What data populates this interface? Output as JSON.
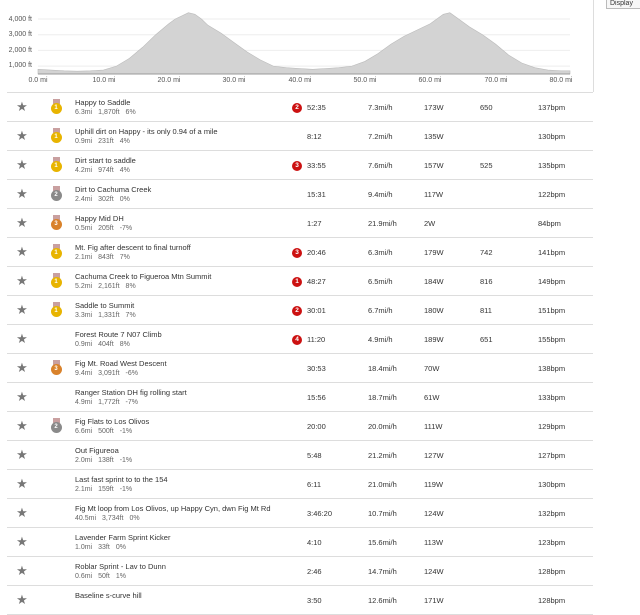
{
  "display_button": "Display",
  "chart": {
    "y_ticks": [
      "4,000 ft",
      "3,000 ft",
      "2,000 ft",
      "1,000 ft"
    ],
    "x_ticks": [
      "0.0 mi",
      "10.0 mi",
      "20.0 mi",
      "30.0 mi",
      "40.0 mi",
      "50.0 mi",
      "60.0 mi",
      "70.0 mi",
      "80.0 mi"
    ],
    "fill_color": "#d3d3d3"
  },
  "chart_data": {
    "type": "area",
    "xlabel": "",
    "ylabel": "",
    "xlim": [
      0,
      80
    ],
    "ylim": [
      500,
      4700
    ],
    "x": [
      0,
      2,
      4,
      6,
      8,
      10,
      12,
      14,
      16,
      18,
      20,
      21,
      22,
      23,
      24,
      25,
      26,
      28,
      30,
      32,
      34,
      36,
      38,
      40,
      42,
      44,
      46,
      48,
      50,
      52,
      54,
      56,
      58,
      60,
      61,
      62,
      63,
      64,
      65,
      66,
      68,
      70,
      72,
      74,
      76,
      78,
      80
    ],
    "y": [
      800,
      750,
      700,
      680,
      700,
      750,
      1000,
      1500,
      2200,
      3000,
      3700,
      4000,
      4200,
      4400,
      4300,
      4000,
      3600,
      3100,
      2500,
      1900,
      1400,
      1000,
      900,
      850,
      800,
      850,
      900,
      1000,
      1300,
      1800,
      2400,
      2900,
      3300,
      3700,
      4000,
      4300,
      4400,
      4100,
      3800,
      3500,
      3000,
      2400,
      1700,
      1200,
      900,
      750,
      700
    ]
  },
  "colors": {
    "rank_red": "#cc1111",
    "medal_gold": "#e8b400",
    "medal_silver": "#8a8a8a",
    "medal_bronze": "#d9822b",
    "ribbon": "#c9a0a0"
  },
  "segments": [
    {
      "name": "Happy to Saddle",
      "distance": "6.3mi",
      "elev": "1,870ft",
      "grade": "6%",
      "medal": "gold",
      "medal_num": "1",
      "rank": "2",
      "time": "52:35",
      "speed": "7.3mi/h",
      "power": "173W",
      "vam": "650",
      "hr": "137bpm"
    },
    {
      "name": "Uphill dirt on Happy - its only 0.94 of a mile",
      "distance": "0.9mi",
      "elev": "231ft",
      "grade": "4%",
      "medal": "gold",
      "medal_num": "1",
      "rank": "",
      "time": "8:12",
      "speed": "7.2mi/h",
      "power": "135W",
      "vam": "",
      "hr": "130bpm"
    },
    {
      "name": "Dirt start to saddle",
      "distance": "4.2mi",
      "elev": "974ft",
      "grade": "4%",
      "medal": "gold",
      "medal_num": "1",
      "rank": "3",
      "time": "33:55",
      "speed": "7.6mi/h",
      "power": "157W",
      "vam": "525",
      "hr": "135bpm"
    },
    {
      "name": "Dirt to Cachuma Creek",
      "distance": "2.4mi",
      "elev": "302ft",
      "grade": "0%",
      "medal": "silver",
      "medal_num": "2",
      "rank": "",
      "time": "15:31",
      "speed": "9.4mi/h",
      "power": "117W",
      "vam": "",
      "hr": "122bpm"
    },
    {
      "name": "Happy Mid DH",
      "distance": "0.5mi",
      "elev": "205ft",
      "grade": "-7%",
      "medal": "bronze",
      "medal_num": "3",
      "rank": "",
      "time": "1:27",
      "speed": "21.9mi/h",
      "power": "2W",
      "vam": "",
      "hr": "84bpm"
    },
    {
      "name": "Mt. Fig after descent to final turnoff",
      "distance": "2.1mi",
      "elev": "843ft",
      "grade": "7%",
      "medal": "gold",
      "medal_num": "1",
      "rank": "3",
      "time": "20:46",
      "speed": "6.3mi/h",
      "power": "179W",
      "vam": "742",
      "hr": "141bpm"
    },
    {
      "name": "Cachuma Creek to Figueroa Mtn Summit",
      "distance": "5.2mi",
      "elev": "2,161ft",
      "grade": "8%",
      "medal": "gold",
      "medal_num": "1",
      "rank": "1",
      "time": "48:27",
      "speed": "6.5mi/h",
      "power": "184W",
      "vam": "816",
      "hr": "149bpm"
    },
    {
      "name": "Saddle to Summit",
      "distance": "3.3mi",
      "elev": "1,331ft",
      "grade": "7%",
      "medal": "gold",
      "medal_num": "1",
      "rank": "2",
      "time": "30:01",
      "speed": "6.7mi/h",
      "power": "180W",
      "vam": "811",
      "hr": "151bpm"
    },
    {
      "name": "Forest Route 7 N07 Climb",
      "distance": "0.9mi",
      "elev": "404ft",
      "grade": "8%",
      "medal": "",
      "medal_num": "",
      "rank": "4",
      "time": "11:20",
      "speed": "4.9mi/h",
      "power": "189W",
      "vam": "651",
      "hr": "155bpm"
    },
    {
      "name": "Fig Mt. Road West Descent",
      "distance": "9.4mi",
      "elev": "3,091ft",
      "grade": "-6%",
      "medal": "bronze",
      "medal_num": "3",
      "rank": "",
      "time": "30:53",
      "speed": "18.4mi/h",
      "power": "70W",
      "vam": "",
      "hr": "138bpm"
    },
    {
      "name": "Ranger Station DH fig rolling start",
      "distance": "4.9mi",
      "elev": "1,772ft",
      "grade": "-7%",
      "medal": "",
      "medal_num": "",
      "rank": "",
      "time": "15:56",
      "speed": "18.7mi/h",
      "power": "61W",
      "vam": "",
      "hr": "133bpm"
    },
    {
      "name": "Fig Flats to Los Olivos",
      "distance": "6.6mi",
      "elev": "500ft",
      "grade": "-1%",
      "medal": "silver",
      "medal_num": "2",
      "rank": "",
      "time": "20:00",
      "speed": "20.0mi/h",
      "power": "111W",
      "vam": "",
      "hr": "129bpm"
    },
    {
      "name": "Out Figureoa",
      "distance": "2.0mi",
      "elev": "138ft",
      "grade": "-1%",
      "medal": "",
      "medal_num": "",
      "rank": "",
      "time": "5:48",
      "speed": "21.2mi/h",
      "power": "127W",
      "vam": "",
      "hr": "127bpm"
    },
    {
      "name": "Last fast sprint to to the 154",
      "distance": "2.1mi",
      "elev": "159ft",
      "grade": "-1%",
      "medal": "",
      "medal_num": "",
      "rank": "",
      "time": "6:11",
      "speed": "21.0mi/h",
      "power": "119W",
      "vam": "",
      "hr": "130bpm"
    },
    {
      "name": "Fig Mt loop from Los Olivos, up Happy Cyn, dwn Fig Mt Rd",
      "distance": "40.5mi",
      "elev": "3,734ft",
      "grade": "0%",
      "medal": "",
      "medal_num": "",
      "rank": "",
      "time": "3:46:20",
      "speed": "10.7mi/h",
      "power": "124W",
      "vam": "",
      "hr": "132bpm"
    },
    {
      "name": "Lavender Farm Sprint Kicker",
      "distance": "1.0mi",
      "elev": "33ft",
      "grade": "0%",
      "medal": "",
      "medal_num": "",
      "rank": "",
      "time": "4:10",
      "speed": "15.6mi/h",
      "power": "113W",
      "vam": "",
      "hr": "123bpm"
    },
    {
      "name": "Roblar Sprint - Lav to Dunn",
      "distance": "0.6mi",
      "elev": "50ft",
      "grade": "1%",
      "medal": "",
      "medal_num": "",
      "rank": "",
      "time": "2:46",
      "speed": "14.7mi/h",
      "power": "124W",
      "vam": "",
      "hr": "128bpm"
    },
    {
      "name": "Baseline s-curve hill",
      "distance": "",
      "elev": "",
      "grade": "",
      "medal": "",
      "medal_num": "",
      "rank": "",
      "time": "3:50",
      "speed": "12.6mi/h",
      "power": "171W",
      "vam": "",
      "hr": "128bpm"
    }
  ]
}
